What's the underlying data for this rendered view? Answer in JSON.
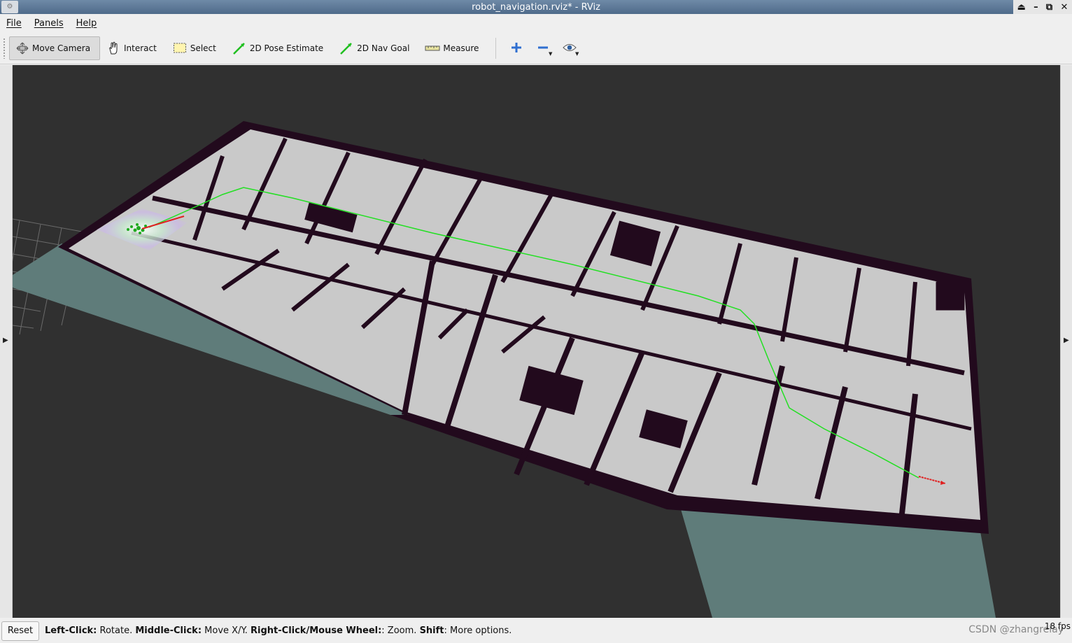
{
  "window": {
    "title": "robot_navigation.rviz* - RViz",
    "controls": [
      "⏏",
      "–",
      "⧉",
      "✕"
    ]
  },
  "menu": [
    {
      "label": "File"
    },
    {
      "label": "Panels"
    },
    {
      "label": "Help"
    }
  ],
  "toolbar": {
    "tools": [
      {
        "label": "Move Camera",
        "icon": "move-camera-icon",
        "active": true
      },
      {
        "label": "Interact",
        "icon": "hand-icon",
        "active": false
      },
      {
        "label": "Select",
        "icon": "select-box-icon",
        "active": false
      },
      {
        "label": "2D Pose Estimate",
        "icon": "green-arrow-icon",
        "active": false
      },
      {
        "label": "2D Nav Goal",
        "icon": "green-arrow-icon",
        "active": false
      },
      {
        "label": "Measure",
        "icon": "ruler-icon",
        "active": false
      }
    ],
    "extra_buttons": [
      "plus-icon",
      "minus-icon",
      "eye-icon"
    ]
  },
  "status": {
    "reset_label": "Reset",
    "hint_parts": [
      {
        "bold": "Left-Click:",
        "text": " Rotate. "
      },
      {
        "bold": "Middle-Click:",
        "text": " Move X/Y. "
      },
      {
        "bold": "Right-Click/Mouse Wheel:",
        "text": ": Zoom. "
      },
      {
        "bold": "Shift",
        "text": ": More options."
      }
    ],
    "fps": "18 fps",
    "watermark": "CSDN @zhangrelay"
  },
  "colors": {
    "viewport_bg": "#303030",
    "free_space": "#c9c9c9",
    "obstacle": "#220a1d",
    "unknown": "#5f7c7a",
    "path": "#22e022",
    "robot_arrow": "#e02020"
  }
}
